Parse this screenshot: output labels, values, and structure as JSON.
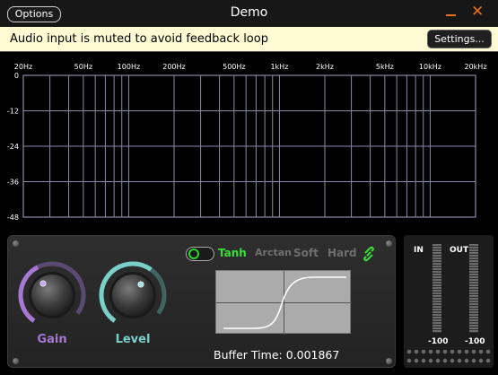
{
  "window": {
    "title": "Demo",
    "options_label": "Options",
    "minimize_icon": "minimize-icon",
    "close_icon": "close-icon",
    "close_glyph": "✕"
  },
  "notice": {
    "text": "Audio input is muted to avoid feedback loop",
    "settings_label": "Settings..."
  },
  "spectrum": {
    "freq_labels": [
      "20Hz",
      "50Hz",
      "100Hz",
      "200Hz",
      "500Hz",
      "1kHz",
      "2kHz",
      "5kHz",
      "10kHz",
      "20kHz"
    ],
    "db_labels": [
      "0",
      "-12",
      "-24",
      "-36",
      "-48"
    ],
    "colors": {
      "grid": "#8a8aa8",
      "label": "#ffffff",
      "background": "#000000"
    }
  },
  "controls": {
    "gain": {
      "label": "Gain",
      "color": "#a678d4"
    },
    "level": {
      "label": "Level",
      "color": "#7ad0c8"
    },
    "modes": [
      {
        "label": "Tanh",
        "active": true
      },
      {
        "label": "Arctan",
        "active": false
      },
      {
        "label": "Soft",
        "active": false
      },
      {
        "label": "Hard",
        "active": false
      }
    ],
    "buffer_label": "Buffer Time: 0.001867",
    "active_color": "#36e036"
  },
  "meters": {
    "in_label": "IN",
    "out_label": "OUT",
    "in_value": "-100",
    "out_value": "-100"
  }
}
